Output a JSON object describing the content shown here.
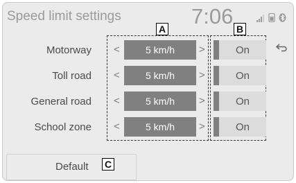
{
  "header": {
    "title": "Speed limit settings",
    "time": "7:06"
  },
  "rows": [
    {
      "label": "Motorway",
      "value": "5 km/h",
      "state": "On"
    },
    {
      "label": "Toll road",
      "value": "5 km/h",
      "state": "On"
    },
    {
      "label": "General road",
      "value": "5 km/h",
      "state": "On"
    },
    {
      "label": "School zone",
      "value": "5 km/h",
      "state": "On"
    }
  ],
  "arrows": {
    "left": "<",
    "right": ">"
  },
  "callouts": {
    "a": "A",
    "b": "B",
    "c": "C"
  },
  "footer": {
    "default_label": "Default"
  },
  "icons": {
    "back": "back-arrow-icon",
    "signal": "signal-icon",
    "phone": "phone-icon",
    "bluetooth": "bluetooth-icon"
  },
  "colors": {
    "background": "#ebebeb",
    "value_bg": "#808080",
    "toggle_bg": "#dcdcdc",
    "text": "#4a4a4a"
  }
}
